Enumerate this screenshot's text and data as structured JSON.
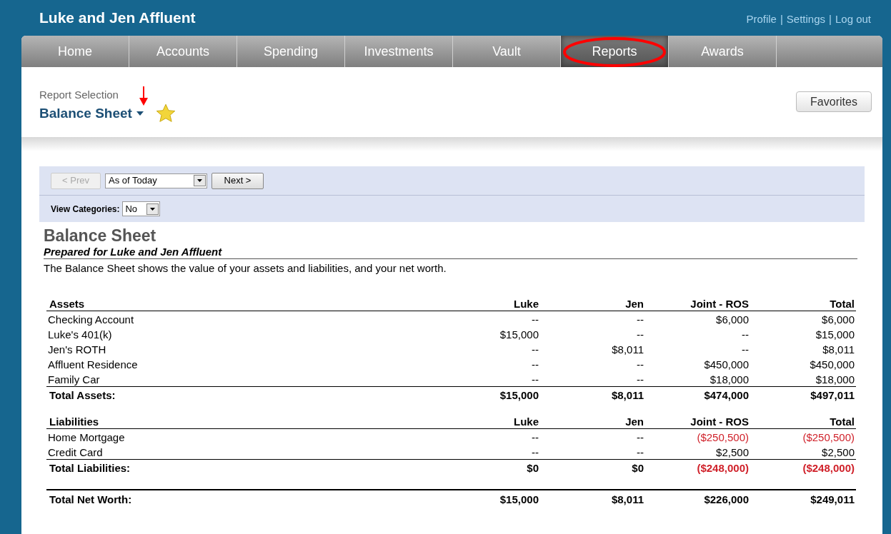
{
  "header": {
    "title": "Luke and Jen Affluent",
    "links": [
      "Profile",
      "Settings",
      "Log out"
    ],
    "separator": "|"
  },
  "tabs": [
    {
      "label": "Home",
      "selected": false
    },
    {
      "label": "Accounts",
      "selected": false
    },
    {
      "label": "Spending",
      "selected": false
    },
    {
      "label": "Investments",
      "selected": false
    },
    {
      "label": "Vault",
      "selected": false
    },
    {
      "label": "Reports",
      "selected": true,
      "highlighted": true
    },
    {
      "label": "Awards",
      "selected": false
    }
  ],
  "report_selection": {
    "label": "Report Selection",
    "value": "Balance Sheet",
    "favorite": true,
    "arrow_annotation": true
  },
  "favorites_button": "Favorites",
  "toolbar": {
    "prev": {
      "label": "< Prev",
      "disabled": true
    },
    "period": "As of Today",
    "next": {
      "label": "Next >",
      "disabled": false
    },
    "view_categories_label": "View Categories:",
    "view_categories_value": "No"
  },
  "report": {
    "title": "Balance Sheet",
    "subtitle": "Prepared for Luke and Jen Affluent",
    "description": "The Balance Sheet shows the value of your assets and liabilities, and your net worth.",
    "sections": [
      {
        "columns": [
          "Assets",
          "Luke",
          "Jen",
          "Joint - ROS",
          "Total"
        ],
        "rows": [
          {
            "label": "Checking Account",
            "values": [
              "--",
              "--",
              "$6,000",
              "$6,000"
            ]
          },
          {
            "label": "Luke's 401(k)",
            "values": [
              "$15,000",
              "--",
              "--",
              "$15,000"
            ]
          },
          {
            "label": "Jen's ROTH",
            "values": [
              "--",
              "$8,011",
              "--",
              "$8,011"
            ]
          },
          {
            "label": "Affluent Residence",
            "values": [
              "--",
              "--",
              "$450,000",
              "$450,000"
            ]
          },
          {
            "label": "Family Car",
            "values": [
              "--",
              "--",
              "$18,000",
              "$18,000"
            ]
          }
        ],
        "total": {
          "label": "Total Assets:",
          "values": [
            "$15,000",
            "$8,011",
            "$474,000",
            "$497,011"
          ]
        }
      },
      {
        "columns": [
          "Liabilities",
          "Luke",
          "Jen",
          "Joint - ROS",
          "Total"
        ],
        "rows": [
          {
            "label": "Home Mortgage",
            "values": [
              "--",
              "--",
              "($250,500)",
              "($250,500)"
            ],
            "negative": [
              false,
              false,
              true,
              true
            ]
          },
          {
            "label": "Credit Card",
            "values": [
              "--",
              "--",
              "$2,500",
              "$2,500"
            ]
          }
        ],
        "total": {
          "label": "Total Liabilities:",
          "values": [
            "$0",
            "$0",
            "($248,000)",
            "($248,000)"
          ],
          "negative": [
            false,
            false,
            true,
            true
          ]
        }
      }
    ],
    "net_worth": {
      "label": "Total Net Worth:",
      "values": [
        "$15,000",
        "$8,011",
        "$226,000",
        "$249,011"
      ]
    }
  }
}
